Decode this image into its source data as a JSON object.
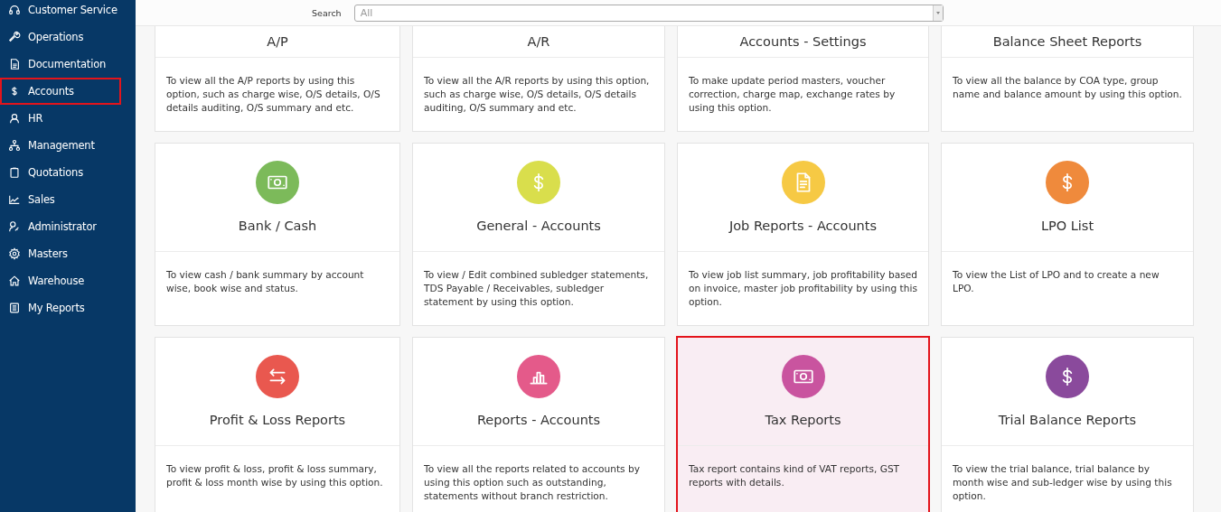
{
  "sidebar": {
    "items": [
      {
        "label": "Customer Service",
        "kind": "headset",
        "selected": false
      },
      {
        "label": "Operations",
        "kind": "wrench",
        "selected": false
      },
      {
        "label": "Documentation",
        "kind": "document",
        "selected": false
      },
      {
        "label": "Accounts",
        "kind": "dollar",
        "selected": true
      },
      {
        "label": "HR",
        "kind": "person",
        "selected": false
      },
      {
        "label": "Management",
        "kind": "hierarchy",
        "selected": false
      },
      {
        "label": "Quotations",
        "kind": "clipboard",
        "selected": false
      },
      {
        "label": "Sales",
        "kind": "chart",
        "selected": false
      },
      {
        "label": "Administrator",
        "kind": "personkey",
        "selected": false
      },
      {
        "label": "Masters",
        "kind": "gear",
        "selected": false
      },
      {
        "label": "Warehouse",
        "kind": "house",
        "selected": false
      },
      {
        "label": "My Reports",
        "kind": "list",
        "selected": false
      }
    ]
  },
  "search": {
    "label": "Search",
    "value": "All"
  },
  "cards": [
    {
      "title": "A/P",
      "description": "To view all the A/P reports by using this option, such as charge wise, O/S details, O/S details auditing, O/S summary and etc.",
      "selected": false
    },
    {
      "title": "A/R",
      "description": "To view all the A/R reports by using this option, such as charge wise, O/S details, O/S details auditing, O/S summary and etc.",
      "selected": false
    },
    {
      "title": "Accounts - Settings",
      "description": "To make update period masters, voucher correction, charge map, exchange rates by using this option.",
      "selected": false
    },
    {
      "title": "Balance Sheet Reports",
      "description": "To view all the balance by COA type, group name and balance amount by using this option.",
      "selected": false
    },
    {
      "title": "Bank / Cash",
      "color": "#7cba5a",
      "kind": "banknote",
      "description": "To view cash / bank summary by account wise, book wise and status.",
      "selected": false
    },
    {
      "title": "General - Accounts",
      "color": "#d9de4c",
      "kind": "dollar",
      "description": "To view / Edit combined subledger statements, TDS Payable / Receivables, subledger statement by using this option.",
      "selected": false
    },
    {
      "title": "Job Reports - Accounts",
      "color": "#f6c944",
      "kind": "document",
      "description": "To view job list summary, job profitability based on invoice, master job profitability by using this option.",
      "selected": false
    },
    {
      "title": "LPO List",
      "color": "#ef8a3c",
      "kind": "dollar",
      "description": "To view the List of LPO and to create a new LPO.",
      "selected": false
    },
    {
      "title": "Profit & Loss Reports",
      "color": "#e9584f",
      "kind": "arrows",
      "description": "To view profit & loss, profit & loss summary, profit & loss month wise by using this option.",
      "selected": false
    },
    {
      "title": "Reports - Accounts",
      "color": "#e45a8a",
      "kind": "bars",
      "description": "To view all the reports related to accounts by using this option such as outstanding, statements without branch restriction.",
      "selected": false
    },
    {
      "title": "Tax Reports",
      "color": "#c9549f",
      "kind": "banknote",
      "description": "Tax report contains kind of VAT reports, GST reports with details.",
      "selected": true
    },
    {
      "title": "Trial Balance Reports",
      "color": "#8a4a9c",
      "kind": "dollar",
      "description": "To view the trial balance, trial balance by month wise and sub-ledger wise by using this option.",
      "selected": false
    }
  ]
}
